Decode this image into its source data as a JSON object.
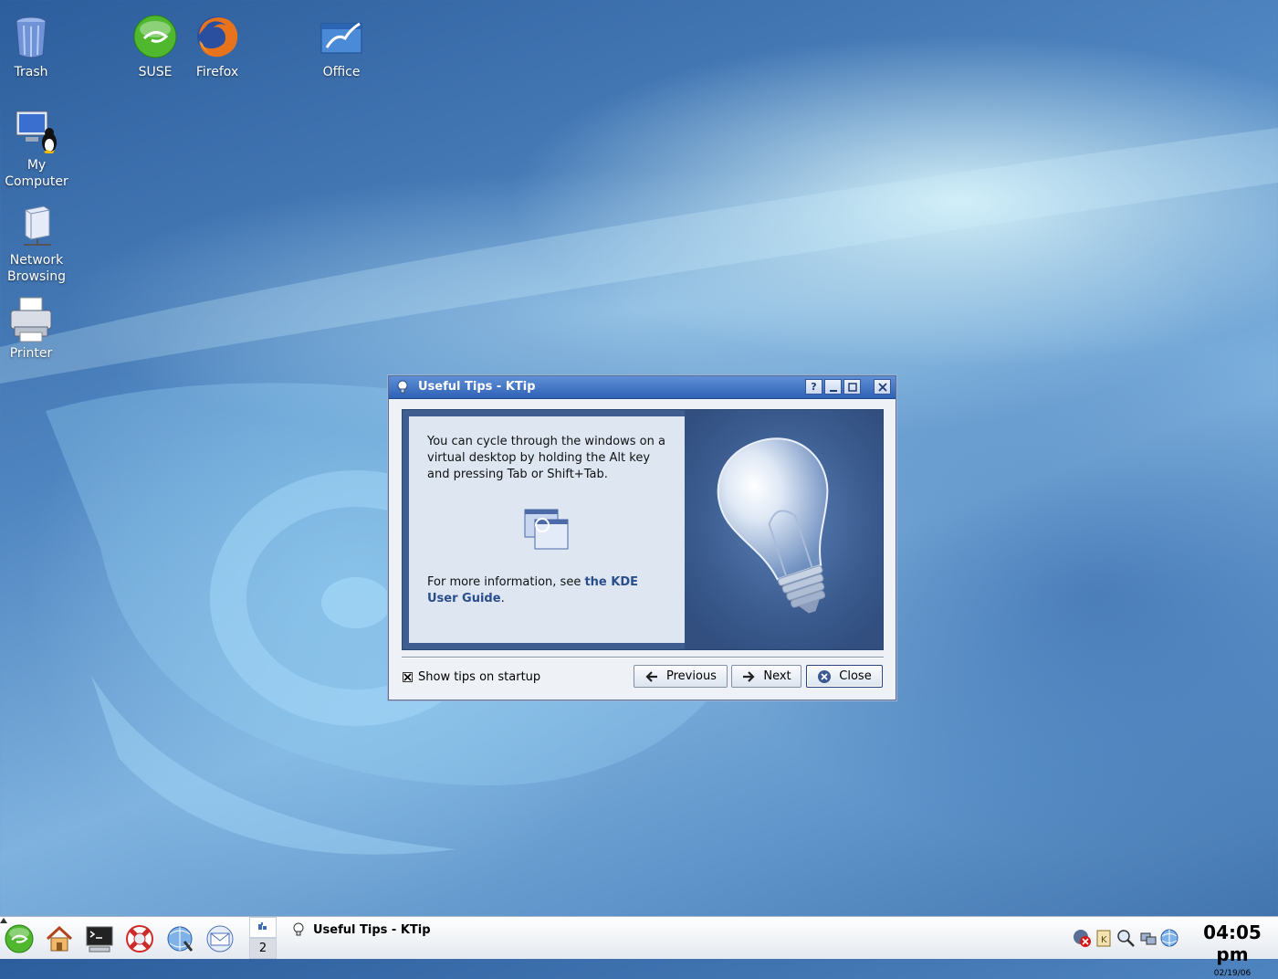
{
  "desktop": {
    "icons": [
      {
        "label": "Trash",
        "icon": "trash-icon"
      },
      {
        "label": "SUSE",
        "icon": "suse-icon"
      },
      {
        "label": "Firefox",
        "icon": "firefox-icon"
      },
      {
        "label": "Office",
        "icon": "office-icon"
      },
      {
        "label": "My\nComputer",
        "icon": "computer-icon"
      },
      {
        "label": "Network\nBrowsing",
        "icon": "network-icon"
      },
      {
        "label": "Printer",
        "icon": "printer-icon"
      }
    ]
  },
  "dialog": {
    "title": "Useful Tips - KTip",
    "tip_text": "You can cycle through the windows on a virtual desktop by holding the Alt key and pressing Tab or Shift+Tab.",
    "more_prefix": "For more information, see ",
    "more_link": "the KDE User Guide",
    "more_suffix": ".",
    "show_tips_label": "Show tips on startup",
    "show_tips_checked": true,
    "previous_label": "Previous",
    "next_label": "Next",
    "close_label": "Close",
    "titlebar_buttons": {
      "help": "?",
      "minimize": "_",
      "maximize": "□",
      "close": "×"
    }
  },
  "taskbar": {
    "pager_desktops": [
      "1",
      "2"
    ],
    "pager_active": "1",
    "task_title": "Useful Tips - KTip",
    "clock_time": "04:05 pm",
    "clock_date": "02/19/06"
  },
  "colors": {
    "titlebar": "#2e62b6",
    "content_bg": "#3f5e8f",
    "tip_panel": "#dde6f1",
    "link": "#2a4d8c"
  }
}
